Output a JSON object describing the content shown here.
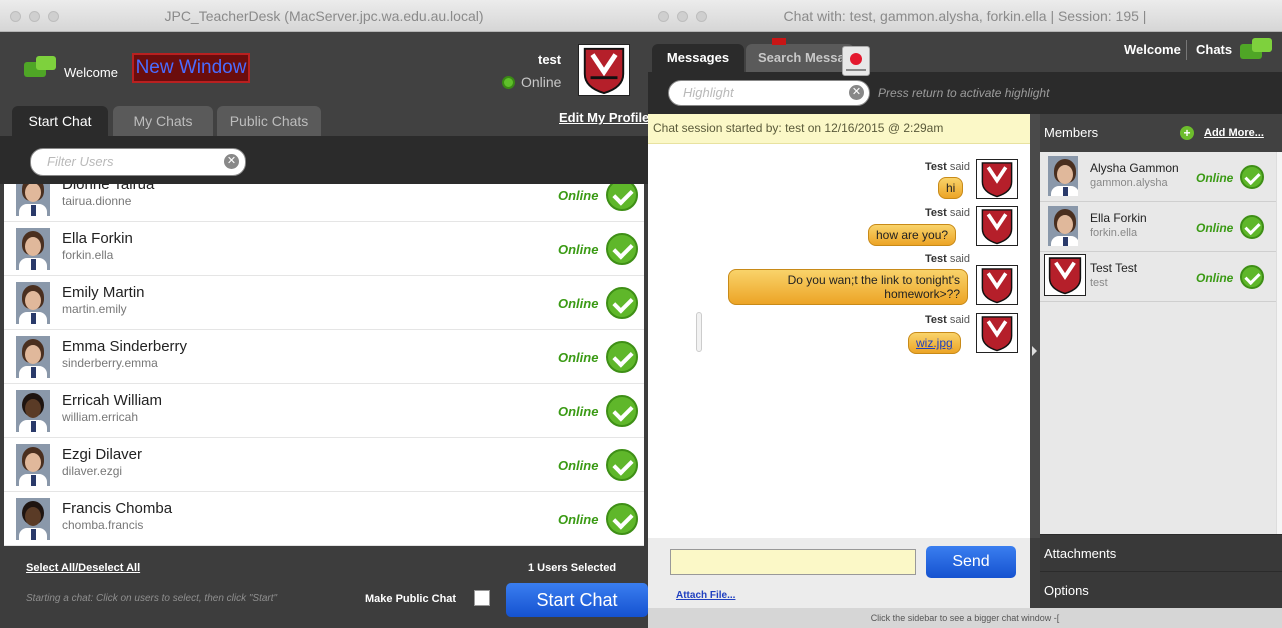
{
  "left_window": {
    "title": "JPC_TeacherDesk (MacServer.jpc.wa.edu.au.local)",
    "welcome": "Welcome",
    "new_window": "New Window",
    "username": "test",
    "status": "Online",
    "tabs": [
      "Start Chat",
      "My Chats",
      "Public Chats"
    ],
    "edit_profile": "Edit My Profile",
    "filter_placeholder": "Filter Users",
    "users": [
      {
        "name": "Dionne Tairua",
        "login": "tairua.dionne",
        "status": "Online"
      },
      {
        "name": "Ella Forkin",
        "login": "forkin.ella",
        "status": "Online"
      },
      {
        "name": "Emily Martin",
        "login": "martin.emily",
        "status": "Online"
      },
      {
        "name": "Emma Sinderberry",
        "login": "sinderberry.emma",
        "status": "Online"
      },
      {
        "name": "Erricah William",
        "login": "william.erricah",
        "status": "Online"
      },
      {
        "name": "Ezgi Dilaver",
        "login": "dilaver.ezgi",
        "status": "Online"
      },
      {
        "name": "Francis Chomba",
        "login": "chomba.francis",
        "status": "Online"
      }
    ],
    "select_all": "Select All/Deselect All",
    "users_selected": "1  Users Selected",
    "hint": "Starting a chat: Click on users to select, then click \"Start\"",
    "make_public": "Make Public Chat",
    "start_chat": "Start Chat"
  },
  "right_window": {
    "title": "Chat with: test, gammon.alysha, forkin.ella | Session: 195 |",
    "tabs": [
      "Messages",
      "Search Messages"
    ],
    "welcome": "Welcome",
    "chats": "Chats",
    "highlight_placeholder": "Highlight",
    "highlight_note": "Press return to activate highlight",
    "session_started": "Chat session started by: test on 12/16/2015 @ 2:29am",
    "messages": [
      {
        "author": "Test",
        "said": "said",
        "text": "hi"
      },
      {
        "author": "Test",
        "said": "said",
        "text": "how are you?"
      },
      {
        "author": "Test",
        "said": "said",
        "text": "Do you wan;t the link to tonight's homework>??"
      },
      {
        "author": "Test",
        "said": "said",
        "text": "wiz.jpg"
      }
    ],
    "send": "Send",
    "attach": "Attach File...",
    "members_title": "Members",
    "add_more": "Add More...",
    "members": [
      {
        "name": "Alysha Gammon",
        "login": "gammon.alysha",
        "status": "Online"
      },
      {
        "name": "Ella Forkin",
        "login": "forkin.ella",
        "status": "Online"
      },
      {
        "name": "Test Test",
        "login": "test",
        "status": "Online"
      }
    ],
    "attachments": "Attachments",
    "options": "Options",
    "footer_hint": "Click the sidebar to see a bigger chat window -["
  },
  "colors": {
    "online_green": "#5fb72a",
    "bubble": "#f2b842",
    "send_blue": "#1e63e0",
    "session_bg": "#fbf8c7"
  }
}
